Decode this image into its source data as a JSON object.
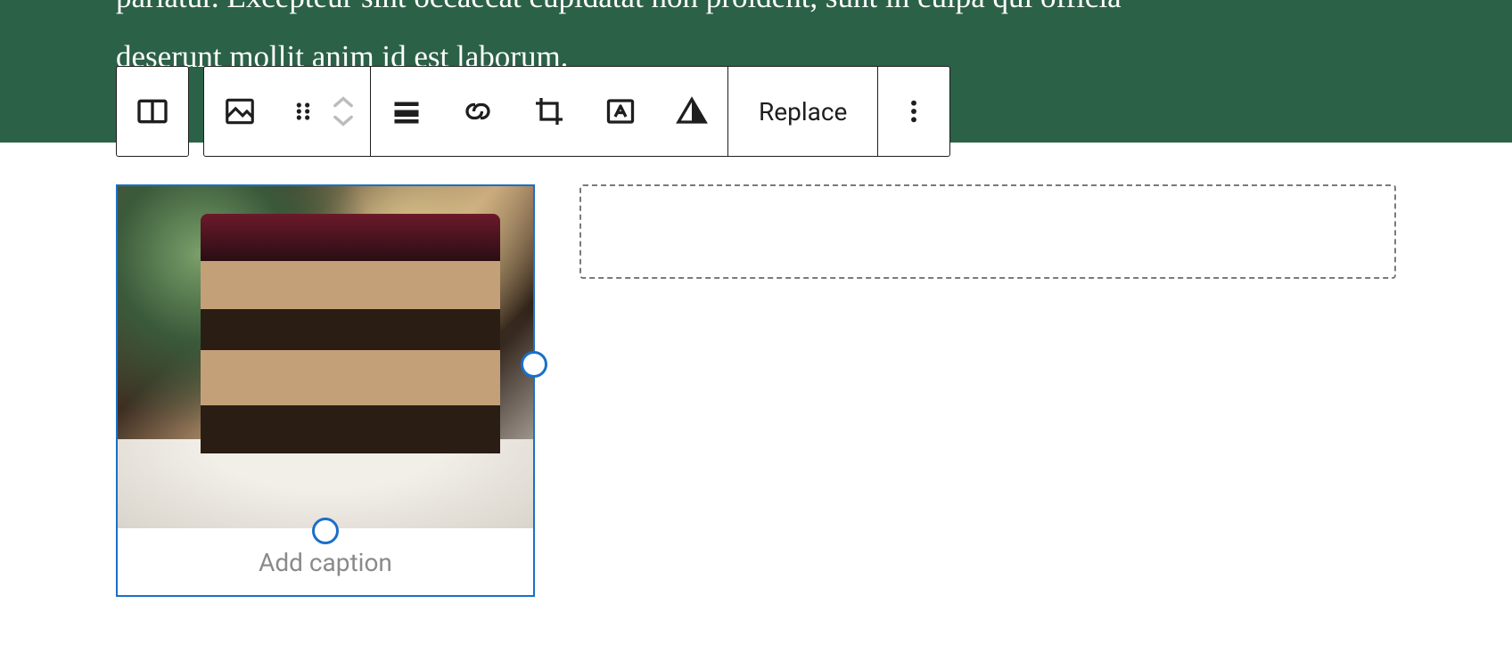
{
  "header": {
    "text_line1": "pariatur. Excepteur sint occaecat cupidatat non proident, sunt in culpa qui officia",
    "text_line2": "deserunt mollit anim id est laborum."
  },
  "toolbar": {
    "replace_label": "Replace",
    "icons": {
      "block_type": "columns-icon",
      "image": "image-icon",
      "drag": "drag-handle-icon",
      "move_up": "chevron-up-icon",
      "move_down": "chevron-down-icon",
      "align": "align-icon",
      "link": "link-icon",
      "crop": "crop-icon",
      "text_overlay": "text-on-image-icon",
      "duotone": "duotone-icon",
      "more": "more-options-icon"
    }
  },
  "image_block": {
    "caption_placeholder": "Add caption"
  }
}
